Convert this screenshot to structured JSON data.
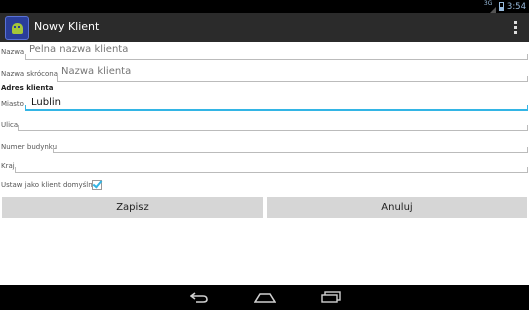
{
  "status_bar": {
    "signal_label": "3G",
    "time": "3:54"
  },
  "action_bar": {
    "title": "Nowy Klient"
  },
  "form": {
    "fields": [
      {
        "label": "Nazwa",
        "value": ""
      },
      {
        "label": "Nazwa skrócona",
        "value": ""
      },
      {
        "label": "Miasto",
        "value": "Lublin"
      },
      {
        "label": "Ulica",
        "value": ""
      },
      {
        "label": "Numer budynku",
        "value": ""
      },
      {
        "label": "Kraj",
        "value": ""
      }
    ],
    "placeholders": {
      "nazwa": "Pelna nazwa klienta",
      "nazwa_skrocona": "Nazwa klienta"
    },
    "section_title": "Adres klienta",
    "default_checkbox": {
      "label": "Ustaw jako klient domyślny",
      "checked": true
    }
  },
  "buttons": {
    "save": "Zapisz",
    "cancel": "Anuluj"
  },
  "colors": {
    "accent": "#33b5e5",
    "action_bar": "#2b2b2b",
    "button_bg": "#d6d6d6"
  }
}
